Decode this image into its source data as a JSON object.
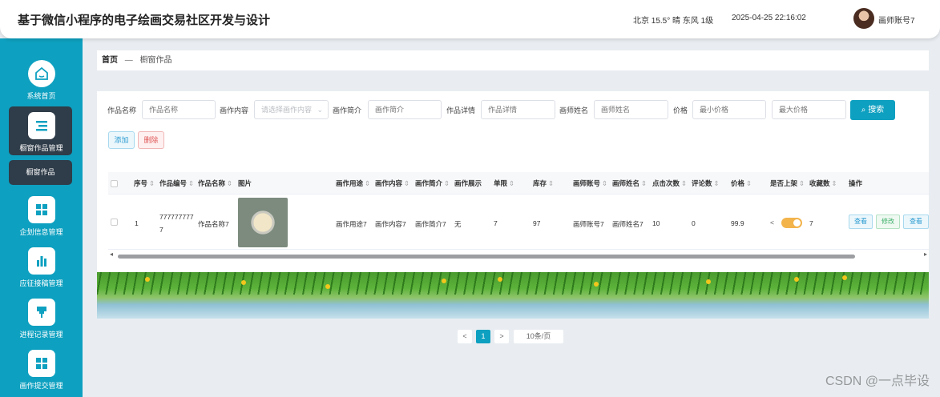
{
  "header": {
    "title": "基于微信小程序的电子绘画交易社区开发与设计",
    "weather": "北京 15.5° 晴 东风 1级",
    "datetime": "2025-04-25 22:16:02",
    "user": "画师账号7"
  },
  "sidebar": {
    "items": [
      {
        "label": "系统首页",
        "icon": "home-icon"
      },
      {
        "label": "橱窗作品管理",
        "icon": "list-icon"
      },
      {
        "label": "企划信息管理",
        "icon": "grid-icon"
      },
      {
        "label": "应征接稿管理",
        "icon": "bar-chart-icon"
      },
      {
        "label": "进程记录管理",
        "icon": "pin-icon"
      },
      {
        "label": "画作提交管理",
        "icon": "grid-icon"
      }
    ],
    "sub_item": "橱窗作品"
  },
  "breadcrumb": {
    "home": "首页",
    "sep": "—",
    "current": "橱窗作品"
  },
  "search": {
    "labels": {
      "name": "作品名称",
      "content": "画作内容",
      "intro": "画作简介",
      "detail": "作品详情",
      "artist": "画师姓名",
      "price": "价格"
    },
    "placeholders": {
      "name": "作品名称",
      "content": "请选择画作内容",
      "intro": "画作简介",
      "detail": "作品详情",
      "artist": "画师姓名",
      "min_price": "最小价格",
      "max_price": "最大价格"
    },
    "button": "搜索"
  },
  "actions": {
    "add": "添加",
    "delete": "删除"
  },
  "table": {
    "headers": [
      "序号",
      "作品编号",
      "作品名称",
      "图片",
      "画作用途",
      "画作内容",
      "画作简介",
      "画作展示",
      "单限",
      "库存",
      "画师账号",
      "画师姓名",
      "点击次数",
      "评论数",
      "价格",
      "是否上架",
      "收藏数",
      "操作"
    ],
    "row": {
      "index": "1",
      "code_line1": "777777777",
      "code_line2": "7",
      "name": "作品名称7",
      "usage": "画作用途7",
      "content": "画作内容7",
      "intro": "画作简介7",
      "display": "无",
      "limit": "7",
      "stock": "97",
      "artist_account": "画师账号7",
      "artist_name": "画师姓名7",
      "clicks": "10",
      "comments": "0",
      "price": "99.9",
      "listed": true,
      "favorites": "7",
      "ops": [
        "查看",
        "修改",
        "查看"
      ]
    }
  },
  "pagination": {
    "prev": "<",
    "page": "1",
    "next": ">",
    "size": "10条/页"
  },
  "watermark": "CSDN @一点毕设",
  "colors": {
    "accent": "#0ea0c0",
    "sidebar_active": "#2f3c49",
    "toggle": "#f3b44c"
  }
}
